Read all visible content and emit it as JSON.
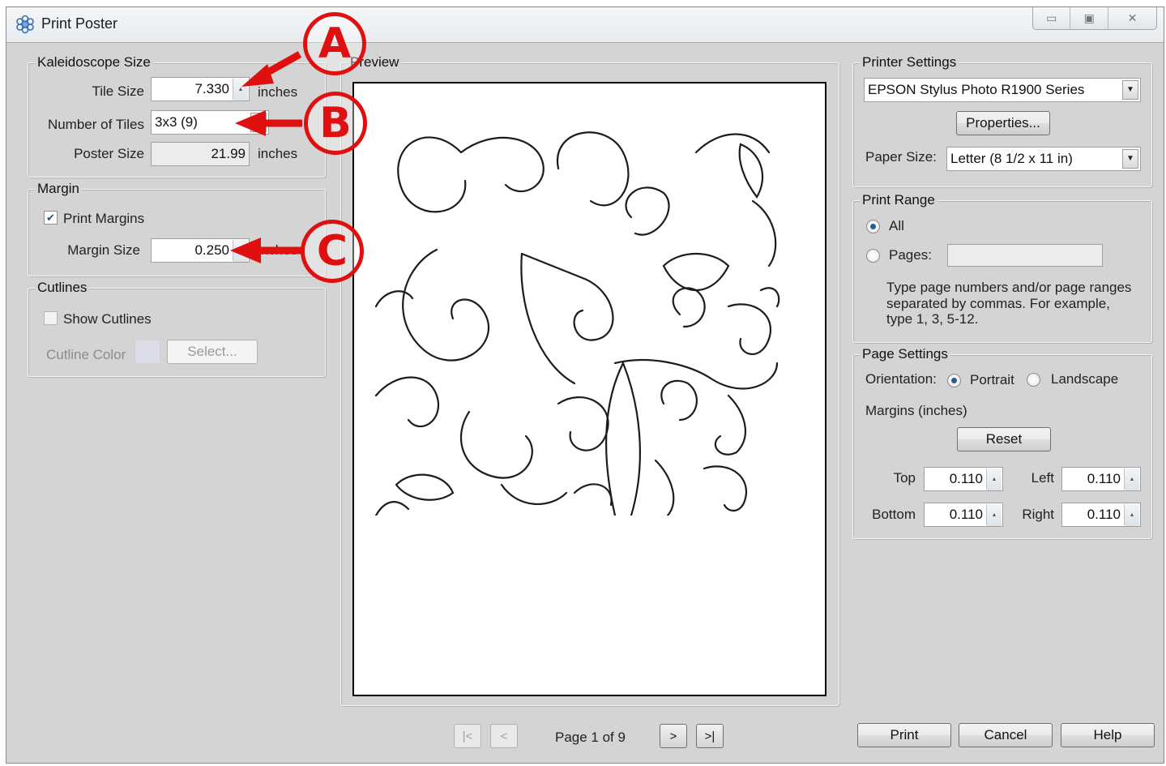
{
  "window": {
    "title": "Print Poster",
    "controls": {
      "minimize": "▭",
      "maximize": "▣",
      "close": "✕"
    }
  },
  "kaleidoscope": {
    "legend": "Kaleidoscope Size",
    "tile_size_label": "Tile Size",
    "tile_size_value": "7.330",
    "tile_size_unit": "inches",
    "num_tiles_label": "Number of Tiles",
    "num_tiles_value": "3x3 (9)",
    "poster_size_label": "Poster Size",
    "poster_size_value": "21.99",
    "poster_size_unit": "inches"
  },
  "margin": {
    "legend": "Margin",
    "print_margins_label": "Print Margins",
    "print_margins_checked": true,
    "margin_size_label": "Margin Size",
    "margin_size_value": "0.250",
    "margin_size_unit": "inches"
  },
  "cutlines": {
    "legend": "Cutlines",
    "show_cutlines_label": "Show Cutlines",
    "cutline_color_label": "Cutline Color",
    "select_label": "Select..."
  },
  "preview": {
    "legend": "Preview",
    "page_label": "Page 1 of 9",
    "nav": {
      "first": "|<",
      "prev": "<",
      "next": ">",
      "last": ">|"
    }
  },
  "printer": {
    "legend": "Printer Settings",
    "printer_name": "EPSON Stylus Photo R1900 Series",
    "properties_label": "Properties...",
    "paper_size_label": "Paper Size:",
    "paper_size_value": "Letter (8 1/2 x 11 in)"
  },
  "print_range": {
    "legend": "Print Range",
    "all_label": "All",
    "pages_label": "Pages:",
    "pages_value": "",
    "help_text_1": "Type page numbers and/or page ranges",
    "help_text_2": "separated by commas.  For example,",
    "help_text_3": "type 1, 3, 5-12."
  },
  "page_settings": {
    "legend": "Page Settings",
    "orientation_label": "Orientation:",
    "portrait_label": "Portrait",
    "landscape_label": "Landscape",
    "margins_label": "Margins (inches)",
    "reset_label": "Reset",
    "top_label": "Top",
    "top_value": "0.110",
    "left_label": "Left",
    "left_value": "0.110",
    "bottom_label": "Bottom",
    "bottom_value": "0.110",
    "right_label": "Right",
    "right_value": "0.110"
  },
  "actions": {
    "print": "Print",
    "cancel": "Cancel",
    "help": "Help"
  },
  "callouts": {
    "a": "A",
    "b": "B",
    "c": "C"
  },
  "colors": {
    "callout": "#e01010",
    "dialog_bg": "#d4d4d4",
    "radio_dot": "#2c5a8c"
  }
}
